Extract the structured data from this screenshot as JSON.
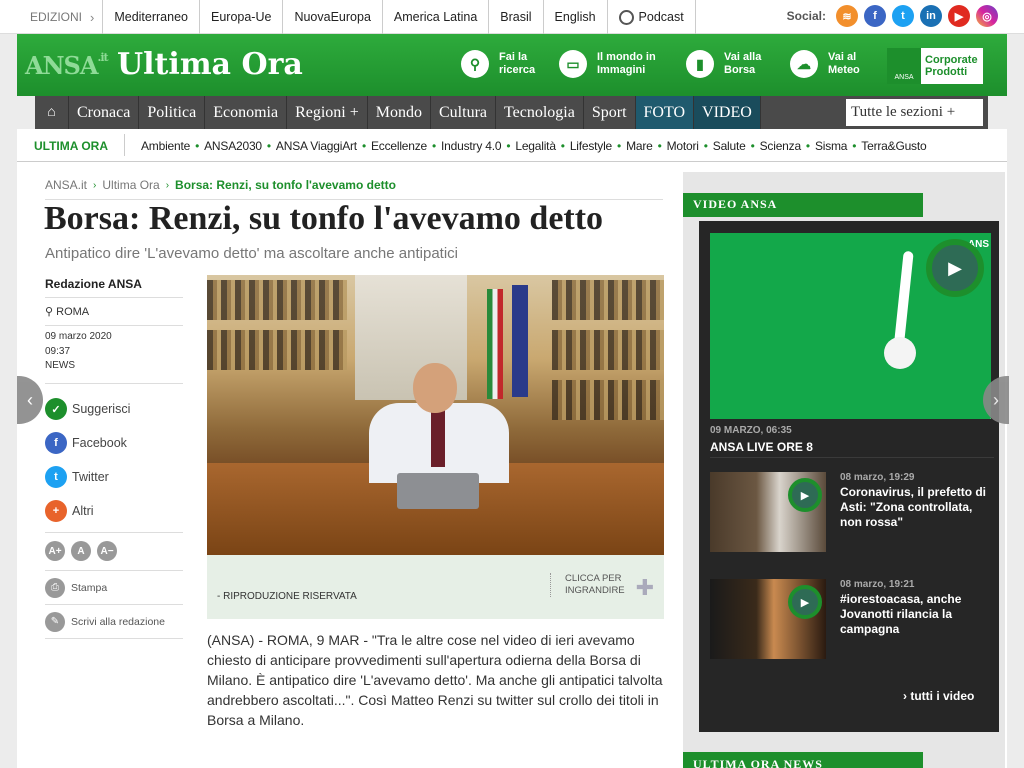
{
  "topbar": {
    "editions": "EDIZIONI",
    "links": [
      "Mediterraneo",
      "Europa-Ue",
      "NuovaEuropa",
      "America Latina",
      "Brasil",
      "English",
      "Podcast"
    ],
    "social_label": "Social:"
  },
  "header": {
    "logo_ansa": "ANSA",
    "logo_it": ".it",
    "logo_title": "Ultima Ora",
    "links": [
      {
        "icon": "search-icon",
        "label": "Fai la\nricerca"
      },
      {
        "icon": "monitor-icon",
        "label": "Il mondo in\nImmagini"
      },
      {
        "icon": "chart-icon",
        "label": "Vai alla\nBorsa"
      },
      {
        "icon": "weather-icon",
        "label": "Vai al\nMeteo"
      }
    ],
    "corporate": "Corporate\nProdotti",
    "corporate_badge": "ANSA"
  },
  "nav": {
    "items": [
      "Cronaca",
      "Politica",
      "Economia",
      "Regioni +",
      "Mondo",
      "Cultura",
      "Tecnologia",
      "Sport",
      "FOTO",
      "VIDEO"
    ],
    "all_sections": "Tutte le sezioni +"
  },
  "subnav": {
    "label": "ULTIMA ORA",
    "items": [
      "Ambiente",
      "ANSA2030",
      "ANSA ViaggiArt",
      "Eccellenze",
      "Industry 4.0",
      "Legalità",
      "Lifestyle",
      "Mare",
      "Motori",
      "Salute",
      "Scienza",
      "Sisma",
      "Terra&Gusto"
    ]
  },
  "breadcrumb": {
    "home": "ANSA.it",
    "section": "Ultima Ora",
    "current": "Borsa: Renzi, su tonfo l'avevamo detto"
  },
  "article": {
    "title": "Borsa: Renzi, su tonfo l'avevamo detto",
    "subtitle": "Antipatico dire 'L'avevamo detto' ma ascoltare anche antipatici",
    "author": "Redazione ANSA",
    "place": "ROMA",
    "date": "09 marzo 2020",
    "time": "09:37",
    "type": "NEWS",
    "caption": "- RIPRODUZIONE RISERVATA",
    "enlarge": "CLICCA PER INGRANDIRE",
    "body": "(ANSA) - ROMA, 9 MAR - \"Tra le altre cose nel video di ieri avevamo chiesto di anticipare provvedimenti sull'apertura odierna della Borsa di Milano. È antipatico dire 'L'avevamo detto'. Ma anche gli antipatici talvolta andrebbero ascoltati...\". Così Matteo Renzi su twitter sul crollo dei titoli in Borsa a Milano."
  },
  "share": {
    "suggest": "Suggerisci",
    "facebook": "Facebook",
    "twitter": "Twitter",
    "others": "Altri",
    "font_up": "A+",
    "font_norm": "A",
    "font_down": "A−",
    "print": "Stampa",
    "write": "Scrivi alla redazione"
  },
  "sidebar": {
    "video_header": "VIDEO ANSA",
    "main_badge": "ANS",
    "main_date": "09 MARZO, 06:35",
    "main_title": "ANSA LIVE ORE 8",
    "items": [
      {
        "date": "08 marzo, 19:29",
        "title": "Coronavirus, il prefetto di Asti: \"Zona controllata, non rossa\""
      },
      {
        "date": "08 marzo, 19:21",
        "title": "#iorestoacasa, anche Jovanotti rilancia la campagna"
      }
    ],
    "all_videos": "› tutti i video",
    "latest_header": "ULTIMA ORA NEWS"
  },
  "colors": {
    "brand_green": "#1d8f2c",
    "nav_dark": "#4a4a4a",
    "video_bg": "#262626"
  }
}
